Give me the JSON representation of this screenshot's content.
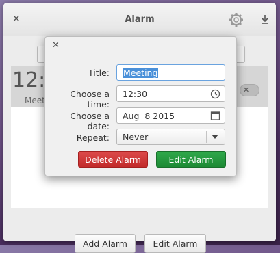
{
  "window": {
    "title": "Alarm"
  },
  "alarm_item": {
    "time": "12:",
    "title": "Meet"
  },
  "bottom": {
    "add_label": "Add Alarm",
    "edit_label": "Edit Alarm"
  },
  "dialog": {
    "title_label": "Title:",
    "title_value": "Meeting",
    "time_label": "Choose a time:",
    "time_value": "12:30",
    "date_label": "Choose a date:",
    "date_value": "Aug  8 2015",
    "repeat_label": "Repeat:",
    "repeat_value": "Never",
    "delete_label": "Delete Alarm",
    "edit_label": "Edit Alarm"
  },
  "colors": {
    "delete": "#c22b2b",
    "edit": "#1d8a35",
    "selection": "#4a90d9"
  },
  "icons": [
    "close-icon",
    "gear-icon",
    "download-icon",
    "clock-icon",
    "calendar-icon",
    "dropdown-arrow-icon"
  ]
}
